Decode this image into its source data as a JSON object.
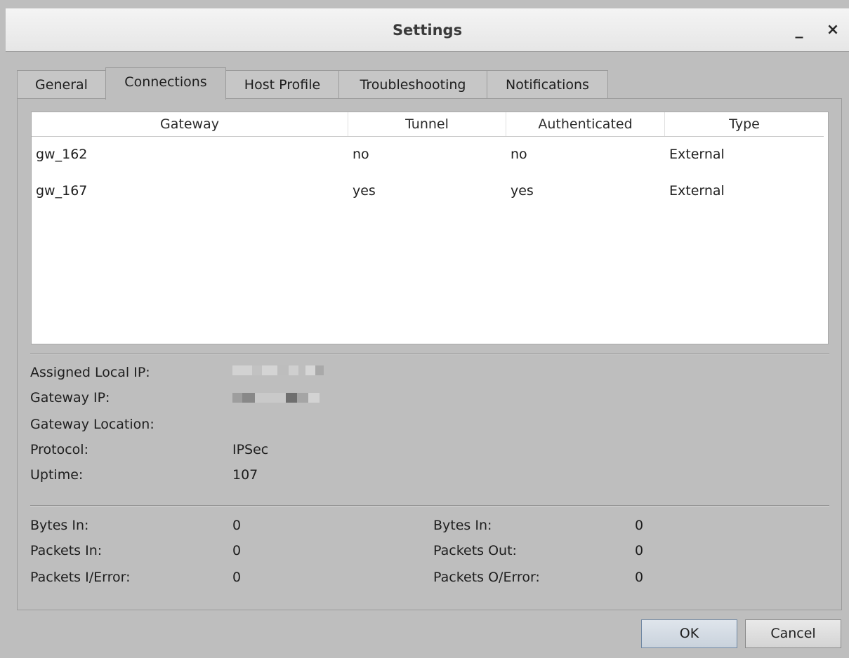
{
  "window": {
    "title": "Settings",
    "minimize_glyph": "_",
    "close_glyph": "×"
  },
  "tabs": [
    {
      "label": "General"
    },
    {
      "label": "Connections"
    },
    {
      "label": "Host Profile"
    },
    {
      "label": "Troubleshooting"
    },
    {
      "label": "Notifications"
    }
  ],
  "active_tab": "Connections",
  "table": {
    "columns": [
      "Gateway",
      "Tunnel",
      "Authenticated",
      "Type"
    ],
    "rows": [
      [
        "gw_162",
        "no",
        "no",
        "External"
      ],
      [
        "gw_167",
        "yes",
        "yes",
        "External"
      ]
    ]
  },
  "details": {
    "assigned_local_ip_label": "Assigned Local IP:",
    "gateway_ip_label": "Gateway IP:",
    "gateway_location_label": "Gateway Location:",
    "gateway_location_value": "",
    "protocol_label": "Protocol:",
    "protocol_value": "IPSec",
    "uptime_label": "Uptime:",
    "uptime_value": "107"
  },
  "stats": {
    "bytes_in_label": "Bytes In:",
    "bytes_in_value": "0",
    "packets_in_label": "Packets In:",
    "packets_in_value": "0",
    "packets_ierror_label": "Packets I/Error:",
    "packets_ierror_value": "0",
    "bytes_in2_label": "Bytes In:",
    "bytes_in2_value": "0",
    "packets_out_label": "Packets Out:",
    "packets_out_value": "0",
    "packets_oerror_label": "Packets O/Error:",
    "packets_oerror_value": "0"
  },
  "buttons": {
    "ok": "OK",
    "cancel": "Cancel"
  }
}
